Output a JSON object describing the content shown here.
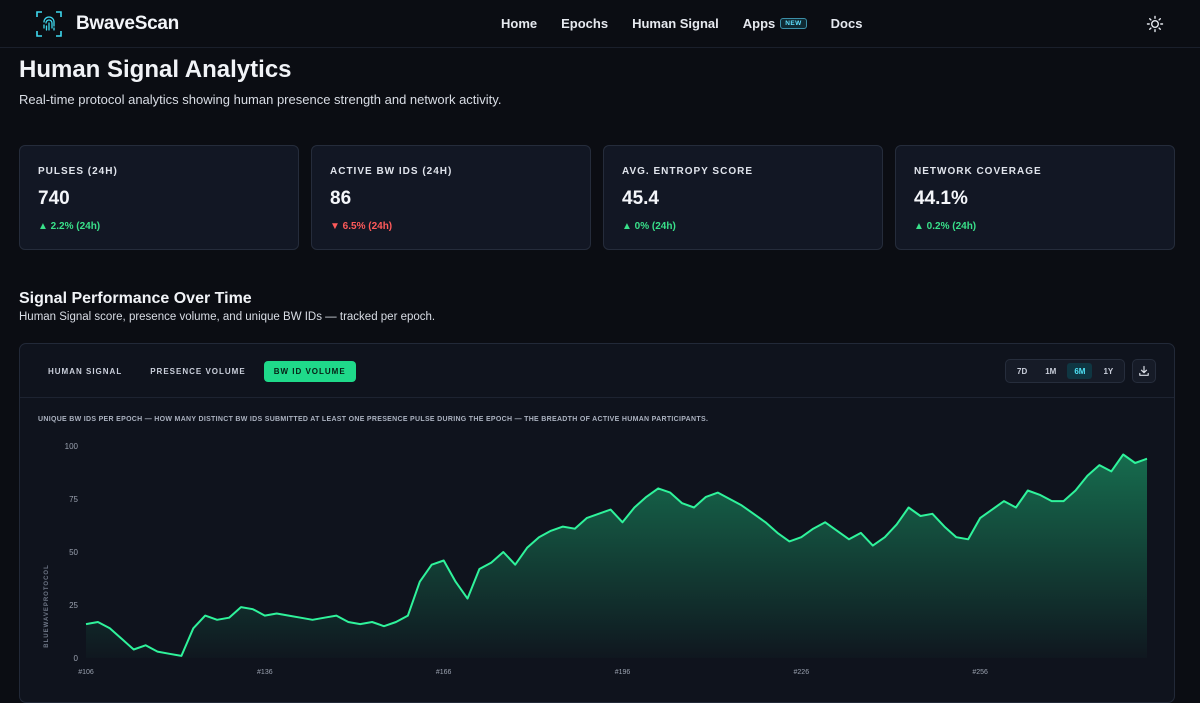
{
  "nav": {
    "brand": "BwaveScan",
    "links": [
      "Home",
      "Epochs",
      "Human Signal",
      "Apps",
      "Docs"
    ],
    "apps_badge": "NEW"
  },
  "header": {
    "title": "Human Signal Analytics",
    "subtitle": "Real-time protocol analytics showing human presence strength and network activity."
  },
  "stats": [
    {
      "label": "PULSES (24H)",
      "value": "740",
      "delta": "▲ 2.2% (24h)",
      "trend": "up"
    },
    {
      "label": "ACTIVE BW IDS (24H)",
      "value": "86",
      "delta": "▼ 6.5% (24h)",
      "trend": "down"
    },
    {
      "label": "AVG. ENTROPY SCORE",
      "value": "45.4",
      "delta": "▲ 0% (24h)",
      "trend": "up"
    },
    {
      "label": "NETWORK COVERAGE",
      "value": "44.1%",
      "delta": "▲ 0.2% (24h)",
      "trend": "up"
    }
  ],
  "section": {
    "title": "Signal Performance Over Time",
    "subtitle": "Human Signal score, presence volume, and unique BW IDs — tracked per epoch."
  },
  "panel": {
    "tabs": [
      "HUMAN SIGNAL",
      "PRESENCE VOLUME",
      "BW ID VOLUME"
    ],
    "active_tab": 2,
    "ranges": [
      "7D",
      "1M",
      "6M",
      "1Y"
    ],
    "active_range": 2,
    "caption": "UNIQUE BW IDS PER EPOCH — HOW MANY DISTINCT BW IDS SUBMITTED AT LEAST ONE PRESENCE PULSE DURING THE EPOCH — THE BREADTH OF ACTIVE HUMAN PARTICIPANTS."
  },
  "colors": {
    "accent": "#1fd98a",
    "up": "#39e08a",
    "down": "#ff5a5a",
    "range_active": "#4fe3f7"
  },
  "chart_data": {
    "type": "area",
    "ylabel": "BLUEWAVEPROTOCOL",
    "ylim": [
      0,
      100
    ],
    "yticks": [
      0,
      25,
      50,
      75,
      100
    ],
    "xlim": [
      106,
      285
    ],
    "xticks": [
      106,
      136,
      166,
      196,
      226,
      256
    ],
    "xtick_labels": [
      "#106",
      "#136",
      "#166",
      "#196",
      "#226",
      "#256"
    ],
    "grid": false,
    "series": [
      {
        "x": [
          106,
          108,
          110,
          112,
          114,
          116,
          118,
          120,
          122,
          124,
          126,
          128,
          130,
          132,
          134,
          136,
          138,
          140,
          142,
          144,
          146,
          148,
          150,
          152,
          154,
          156,
          158,
          160,
          162,
          164,
          166,
          168,
          170,
          172,
          174,
          176,
          178,
          180,
          182,
          184,
          186,
          188,
          190,
          192,
          194,
          196,
          198,
          200,
          202,
          204,
          206,
          208,
          210,
          212,
          214,
          216,
          218,
          220,
          222,
          224,
          226,
          228,
          230,
          232,
          234,
          236,
          238,
          240,
          242,
          244,
          246,
          248,
          250,
          252,
          254,
          256,
          258,
          260,
          262,
          264,
          266,
          268,
          270,
          272,
          274,
          276,
          278,
          280,
          282,
          284
        ],
        "y": [
          16,
          17,
          14,
          9,
          4,
          6,
          3,
          2,
          1,
          14,
          20,
          18,
          19,
          24,
          23,
          20,
          21,
          20,
          19,
          18,
          19,
          20,
          17,
          16,
          17,
          15,
          17,
          20,
          36,
          44,
          46,
          36,
          28,
          42,
          45,
          50,
          44,
          52,
          57,
          60,
          62,
          61,
          66,
          68,
          70,
          64,
          71,
          76,
          80,
          78,
          73,
          71,
          76,
          78,
          75,
          72,
          68,
          64,
          59,
          55,
          57,
          61,
          64,
          60,
          56,
          59,
          53,
          57,
          63,
          71,
          67,
          68,
          62,
          57,
          56,
          66,
          70,
          74,
          71,
          79,
          77,
          74,
          74,
          79,
          86,
          91,
          88,
          96,
          92,
          94
        ]
      }
    ]
  }
}
